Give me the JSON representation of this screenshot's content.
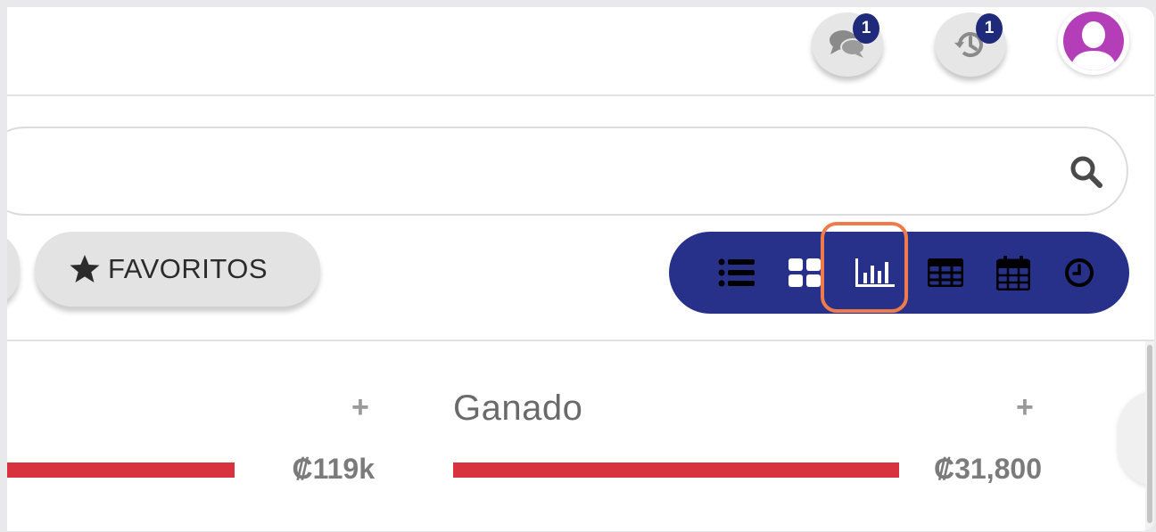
{
  "header": {
    "chat_badge": "1",
    "history_badge": "1"
  },
  "search": {
    "placeholder": "",
    "value": ""
  },
  "filters": {
    "favorites_label": "FAVORITOS"
  },
  "view_bar": {
    "active": "chart",
    "items": [
      "list-view",
      "grid-view",
      "chart-view",
      "table-view",
      "calendar-view",
      "timeline-view"
    ]
  },
  "cards": [
    {
      "title": "",
      "amount": "₡119k"
    },
    {
      "title": "Ganado",
      "amount": "₡31,800"
    }
  ],
  "colors": {
    "primary": "#27318a",
    "badge": "#1f2a7a",
    "bar": "#d8323f",
    "highlight": "#f07b4a",
    "avatar": "#b43db8"
  }
}
